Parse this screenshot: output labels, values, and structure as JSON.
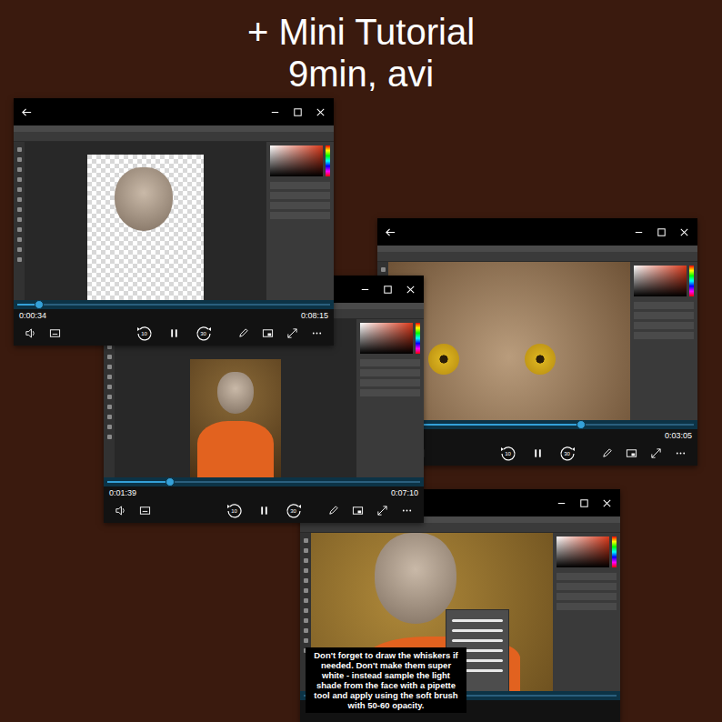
{
  "header": {
    "title": "+ Mini Tutorial",
    "subtitle": "9min, avi"
  },
  "windows": [
    {
      "scene": "cutout",
      "level": 0.07,
      "elapsed": "0:00:34",
      "total": "0:08:15",
      "controls": {
        "skip_back": "10",
        "skip_forward": "30"
      }
    },
    {
      "scene": "portrait",
      "level": 0.2,
      "elapsed": "0:01:39",
      "total": "0:07:10",
      "controls": {
        "skip_back": "10",
        "skip_forward": "30"
      }
    },
    {
      "scene": "closeup",
      "level": 0.64,
      "total": "0:03:05",
      "controls": {
        "skip_back": "10",
        "skip_forward": "30"
      }
    },
    {
      "scene": "whiskers",
      "caption": "Don't forget to draw the whiskers if needed. Don't make them super white - instead sample the light shade from the face with a pipette tool and apply using the soft brush with 50-60 opacity."
    }
  ]
}
